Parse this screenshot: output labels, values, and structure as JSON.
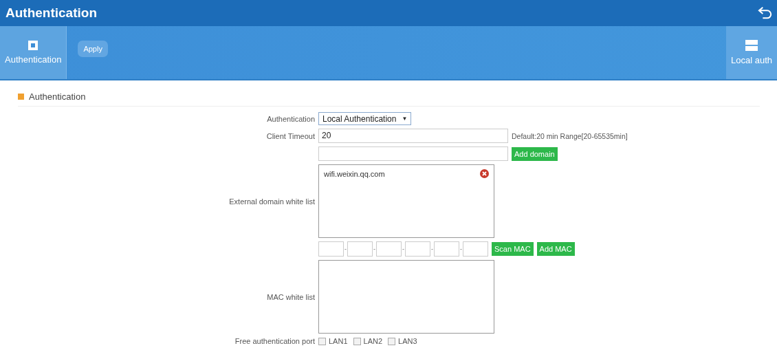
{
  "header": {
    "title": "Authentication"
  },
  "toolbar": {
    "tabs": [
      {
        "label": "Authentication",
        "selected": true
      }
    ],
    "apply": "Apply",
    "right_tab": {
      "label": "Local auth",
      "selected": false
    }
  },
  "section": {
    "title": "Authentication"
  },
  "form": {
    "auth_label": "Authentication",
    "auth_value": "Local Authentication",
    "auth_caret": "▼",
    "timeout_label": "Client Timeout",
    "timeout_value": "20",
    "timeout_hint": "Default:20 min Range[20-65535min]",
    "add_domain": "Add domain",
    "domain_list_label": "External domain white list",
    "domains": [
      "wifi.weixin.qq.com"
    ],
    "mac_separator": "-",
    "scan_mac": "Scan MAC",
    "add_mac": "Add MAC",
    "mac_list_label": "MAC white list",
    "port_label": "Free authentication port",
    "ports": [
      {
        "label": "LAN1",
        "checked": false
      },
      {
        "label": "LAN2",
        "checked": false
      },
      {
        "label": "LAN3",
        "checked": false
      }
    ]
  }
}
